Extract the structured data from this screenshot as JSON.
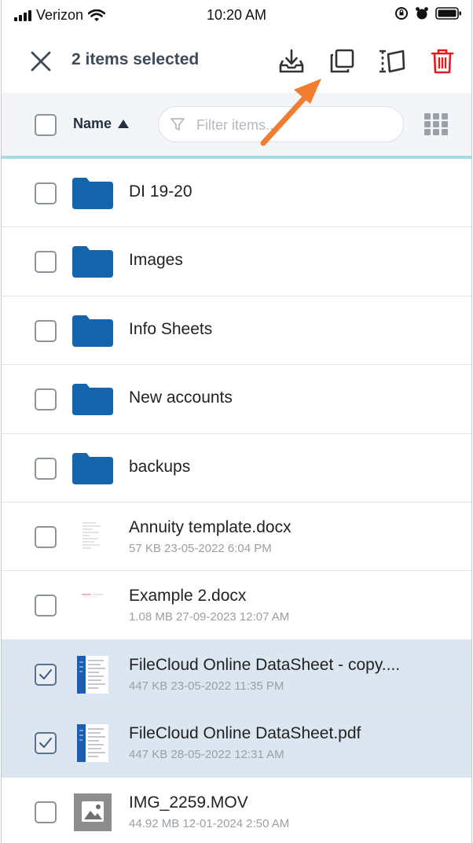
{
  "status_bar": {
    "carrier": "Verizon",
    "time": "10:20 AM"
  },
  "action_bar": {
    "selected_text": "2 items selected",
    "accent_color": "#e31b1b"
  },
  "toolbar": {
    "sort_label": "Name",
    "sort_direction": "ascending",
    "filter_placeholder": "Filter items..."
  },
  "files": [
    {
      "type": "folder",
      "name": "DI 19-20",
      "selected": false
    },
    {
      "type": "folder",
      "name": "Images",
      "selected": false
    },
    {
      "type": "folder",
      "name": "Info Sheets",
      "selected": false
    },
    {
      "type": "folder",
      "name": "New accounts",
      "selected": false
    },
    {
      "type": "folder",
      "name": "backups",
      "selected": false
    },
    {
      "type": "doc",
      "name": "Annuity template.docx",
      "meta": "57 KB 23-05-2022 6:04 PM",
      "selected": false
    },
    {
      "type": "doc",
      "name": "Example 2.docx",
      "meta": "1.08 MB 27-09-2023 12:07 AM",
      "selected": false
    },
    {
      "type": "pdf",
      "name": "FileCloud Online DataSheet - copy....",
      "meta": "447 KB 23-05-2022 11:35 PM",
      "selected": true
    },
    {
      "type": "pdf",
      "name": "FileCloud Online DataSheet.pdf",
      "meta": "447 KB 28-05-2022 12:31 AM",
      "selected": true
    },
    {
      "type": "video",
      "name": "IMG_2259.MOV",
      "meta": "44.92 MB 12-01-2024 2:50 AM",
      "selected": false
    }
  ],
  "colors": {
    "folder": "#1565ad",
    "annotation_arrow": "#f07d32",
    "selected_row": "#dbe6f1"
  }
}
